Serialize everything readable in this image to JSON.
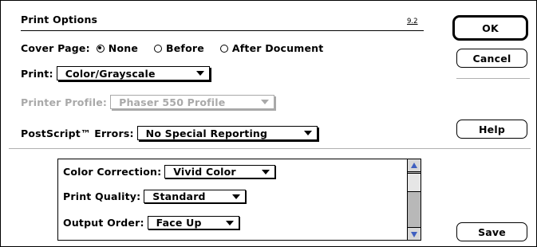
{
  "dialog": {
    "title": "Print Options",
    "version": "9.2"
  },
  "cover_page": {
    "label": "Cover Page:",
    "options": [
      "None",
      "Before",
      "After Document"
    ],
    "selected": "None"
  },
  "print": {
    "label": "Print:",
    "value": "Color/Grayscale"
  },
  "printer_profile": {
    "label": "Printer Profile:",
    "value": "Phaser 550 Profile",
    "enabled": false
  },
  "postscript_errors": {
    "label": "PostScript™ Errors:",
    "value": "No Special Reporting"
  },
  "buttons": {
    "ok": "OK",
    "cancel": "Cancel",
    "help": "Help",
    "save": "Save"
  },
  "options_list": {
    "items": [
      {
        "label": "Color Correction:",
        "value": "Vivid Color"
      },
      {
        "label": "Print Quality:",
        "value": "Standard"
      },
      {
        "label": "Output Order:",
        "value": "Face Up"
      }
    ]
  },
  "icons": {
    "popup_arrow": "triangle-down",
    "scroll_up": "arrow-up",
    "scroll_down": "arrow-down"
  },
  "colors": {
    "disabled_text": "#a9a9a9",
    "scroll_track": "#b8b8b8",
    "scroll_arrow": "#4060c0"
  }
}
